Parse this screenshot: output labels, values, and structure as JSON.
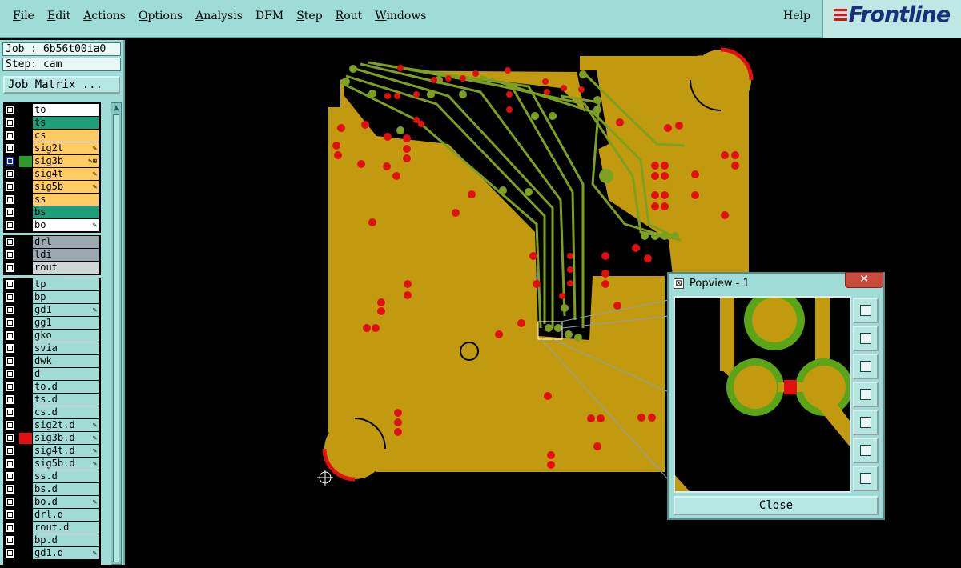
{
  "menu": {
    "items": [
      {
        "label": "File",
        "ul": "F",
        "rest": "ile"
      },
      {
        "label": "Edit",
        "ul": "E",
        "rest": "dit"
      },
      {
        "label": "Actions",
        "ul": "A",
        "rest": "ctions"
      },
      {
        "label": "Options",
        "ul": "O",
        "rest": "ptions"
      },
      {
        "label": "Analysis",
        "ul": "A",
        "rest": "nalysis"
      },
      {
        "label": "DFM",
        "ul": "",
        "rest": "DFM"
      },
      {
        "label": "Step",
        "ul": "S",
        "rest": "tep"
      },
      {
        "label": "Rout",
        "ul": "R",
        "rest": "out"
      },
      {
        "label": "Windows",
        "ul": "W",
        "rest": "indows"
      }
    ],
    "help": "Help"
  },
  "brand": {
    "logo_text": "Frontline"
  },
  "sidebar": {
    "job": "Job : 6b56t00ia0",
    "step": "Step: cam",
    "job_matrix": "Job Matrix ..."
  },
  "layers": [
    {
      "name": "to",
      "color": "#ffffff",
      "mark": ""
    },
    {
      "name": "ts",
      "color": "#1e9e7a",
      "mark": ""
    },
    {
      "name": "cs",
      "color": "#ffcb63",
      "mark": ""
    },
    {
      "name": "sig2t",
      "color": "#ffcb63",
      "mark": "✎"
    },
    {
      "name": "sig3b",
      "color": "#ffcb63",
      "mark": "✎⊞",
      "on": true,
      "swatch": "#2a9a2a"
    },
    {
      "name": "sig4t",
      "color": "#ffcb63",
      "mark": "✎"
    },
    {
      "name": "sig5b",
      "color": "#ffcb63",
      "mark": "✎"
    },
    {
      "name": "ss",
      "color": "#ffcb63",
      "mark": ""
    },
    {
      "name": "bs",
      "color": "#1e9e7a",
      "mark": ""
    },
    {
      "name": "bo",
      "color": "#ffffff",
      "mark": "✎"
    },
    {
      "name": "drl",
      "color": "#9aa8b0",
      "mark": "",
      "gap": true
    },
    {
      "name": "ldi",
      "color": "#9aa8b0",
      "mark": ""
    },
    {
      "name": "rout",
      "color": "#cfd6d8",
      "mark": ""
    },
    {
      "name": "tp",
      "color": "#9fdcd8",
      "mark": "",
      "gap": true
    },
    {
      "name": "bp",
      "color": "#9fdcd8",
      "mark": ""
    },
    {
      "name": "gd1",
      "color": "#9fdcd8",
      "mark": "✎"
    },
    {
      "name": "gg1",
      "color": "#9fdcd8",
      "mark": ""
    },
    {
      "name": "gko",
      "color": "#9fdcd8",
      "mark": ""
    },
    {
      "name": "svia",
      "color": "#9fdcd8",
      "mark": ""
    },
    {
      "name": "dwk",
      "color": "#9fdcd8",
      "mark": ""
    },
    {
      "name": "d",
      "color": "#9fdcd8",
      "mark": ""
    },
    {
      "name": "to.d",
      "color": "#9fdcd8",
      "mark": ""
    },
    {
      "name": "ts.d",
      "color": "#9fdcd8",
      "mark": ""
    },
    {
      "name": "cs.d",
      "color": "#9fdcd8",
      "mark": ""
    },
    {
      "name": "sig2t.d",
      "color": "#9fdcd8",
      "mark": "✎"
    },
    {
      "name": "sig3b.d",
      "color": "#9fdcd8",
      "mark": "✎",
      "swatch": "#e01010"
    },
    {
      "name": "sig4t.d",
      "color": "#9fdcd8",
      "mark": "✎"
    },
    {
      "name": "sig5b.d",
      "color": "#9fdcd8",
      "mark": "✎"
    },
    {
      "name": "ss.d",
      "color": "#9fdcd8",
      "mark": ""
    },
    {
      "name": "bs.d",
      "color": "#9fdcd8",
      "mark": ""
    },
    {
      "name": "bo.d",
      "color": "#9fdcd8",
      "mark": "✎"
    },
    {
      "name": "drl.d",
      "color": "#9fdcd8",
      "mark": ""
    },
    {
      "name": "rout.d",
      "color": "#9fdcd8",
      "mark": ""
    },
    {
      "name": "bp.d",
      "color": "#9fdcd8",
      "mark": ""
    },
    {
      "name": "gd1.d",
      "color": "#9fdcd8",
      "mark": "✎"
    }
  ],
  "popview": {
    "title": "Popview - 1",
    "close_x": "✕",
    "close_label": "Close",
    "tools": [
      "zoom-window-icon",
      "pan-up-icon",
      "pan-down-icon",
      "pan-left-icon",
      "pan-right-icon",
      "zoom-fit-icon",
      "zoom-home-icon"
    ]
  },
  "colors": {
    "copper": "#c29a10",
    "trace_green": "#7ea020",
    "pad_red": "#e01010",
    "bg_panel": "#9fdcd8"
  }
}
